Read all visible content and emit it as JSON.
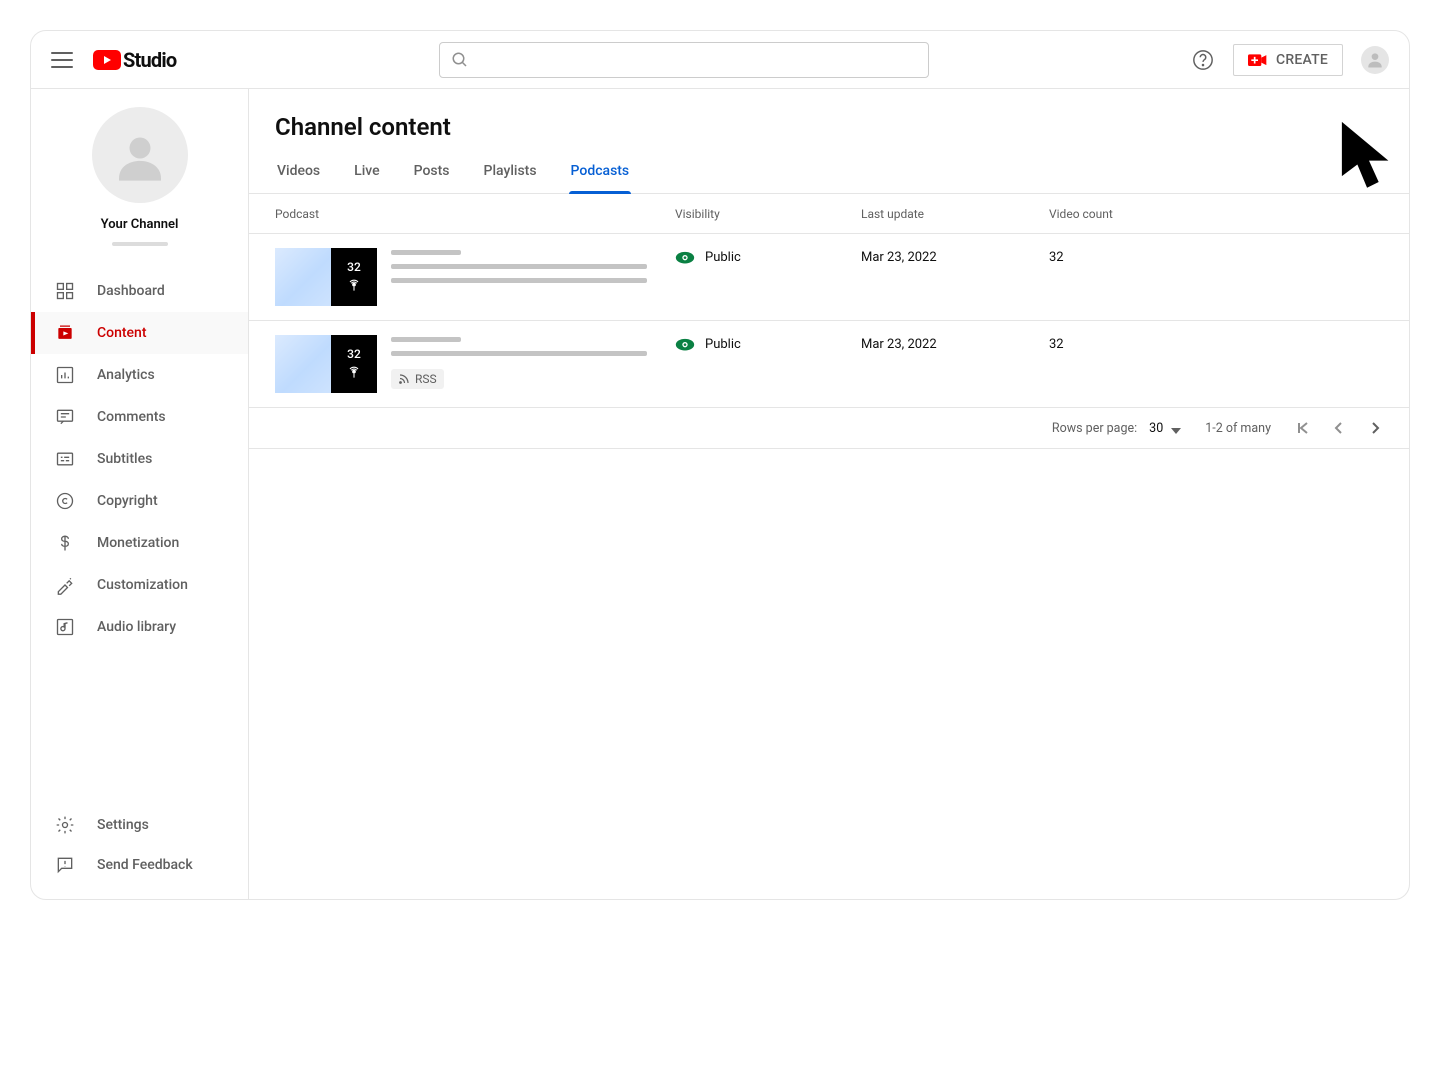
{
  "header": {
    "logo_text": "Studio",
    "search_placeholder": "",
    "create_label": "CREATE"
  },
  "sidebar": {
    "channel_name": "Your Channel",
    "nav": [
      {
        "label": "Dashboard"
      },
      {
        "label": "Content"
      },
      {
        "label": "Analytics"
      },
      {
        "label": "Comments"
      },
      {
        "label": "Subtitles"
      },
      {
        "label": "Copyright"
      },
      {
        "label": "Monetization"
      },
      {
        "label": "Customization"
      },
      {
        "label": "Audio library"
      }
    ],
    "active_index": 1,
    "footer": [
      {
        "label": "Settings"
      },
      {
        "label": "Send Feedback"
      }
    ]
  },
  "page": {
    "title": "Channel content",
    "tabs": [
      "Videos",
      "Live",
      "Posts",
      "Playlists",
      "Podcasts"
    ],
    "active_tab_index": 4
  },
  "table": {
    "columns": {
      "podcast": "Podcast",
      "visibility": "Visibility",
      "last_update": "Last update",
      "video_count": "Video count"
    },
    "rows": [
      {
        "thumb_count": "32",
        "visibility": "Public",
        "last_update": "Mar 23, 2022",
        "video_count": "32",
        "rss": false
      },
      {
        "thumb_count": "32",
        "visibility": "Public",
        "last_update": "Mar 23, 2022",
        "video_count": "32",
        "rss": true,
        "rss_label": "RSS"
      }
    ]
  },
  "pagination": {
    "rows_per_page_label": "Rows per page:",
    "rows_per_page_value": "30",
    "range_label": "1-2 of many"
  }
}
